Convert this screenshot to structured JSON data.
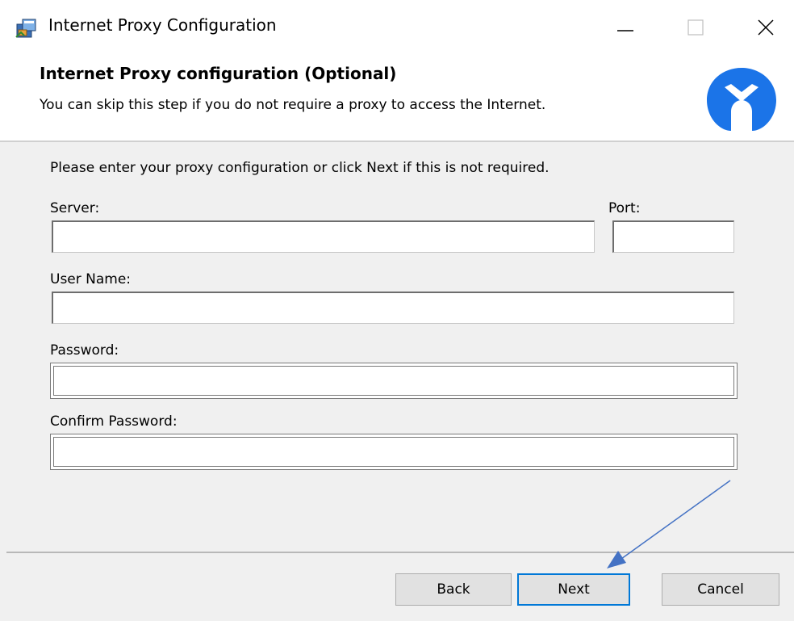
{
  "window": {
    "title": "Internet Proxy Configuration",
    "controls": {
      "minimize": "minimize-icon",
      "maximize": "maximize-icon",
      "close": "close-icon"
    }
  },
  "banner": {
    "title": "Internet Proxy configuration (Optional)",
    "subtitle": "You can skip this step if you do not require a proxy to access the Internet.",
    "logo_icon": "malwarebytes-logo-icon",
    "logo_color": "#1b74e8"
  },
  "form": {
    "instruction": "Please enter your proxy configuration or click Next if this is not required.",
    "server": {
      "label": "Server:",
      "value": "",
      "placeholder": ""
    },
    "port": {
      "label": "Port:",
      "value": "",
      "placeholder": ""
    },
    "username": {
      "label": "User Name:",
      "value": "",
      "placeholder": ""
    },
    "password": {
      "label": "Password:",
      "value": "",
      "placeholder": ""
    },
    "confirm_password": {
      "label": "Confirm Password:",
      "value": "",
      "placeholder": ""
    }
  },
  "buttons": {
    "back": "Back",
    "next": "Next",
    "cancel": "Cancel",
    "default_border_color": "#0078d7"
  },
  "annotation": {
    "arrow_color": "#4472c4",
    "points_to": "next-button"
  }
}
